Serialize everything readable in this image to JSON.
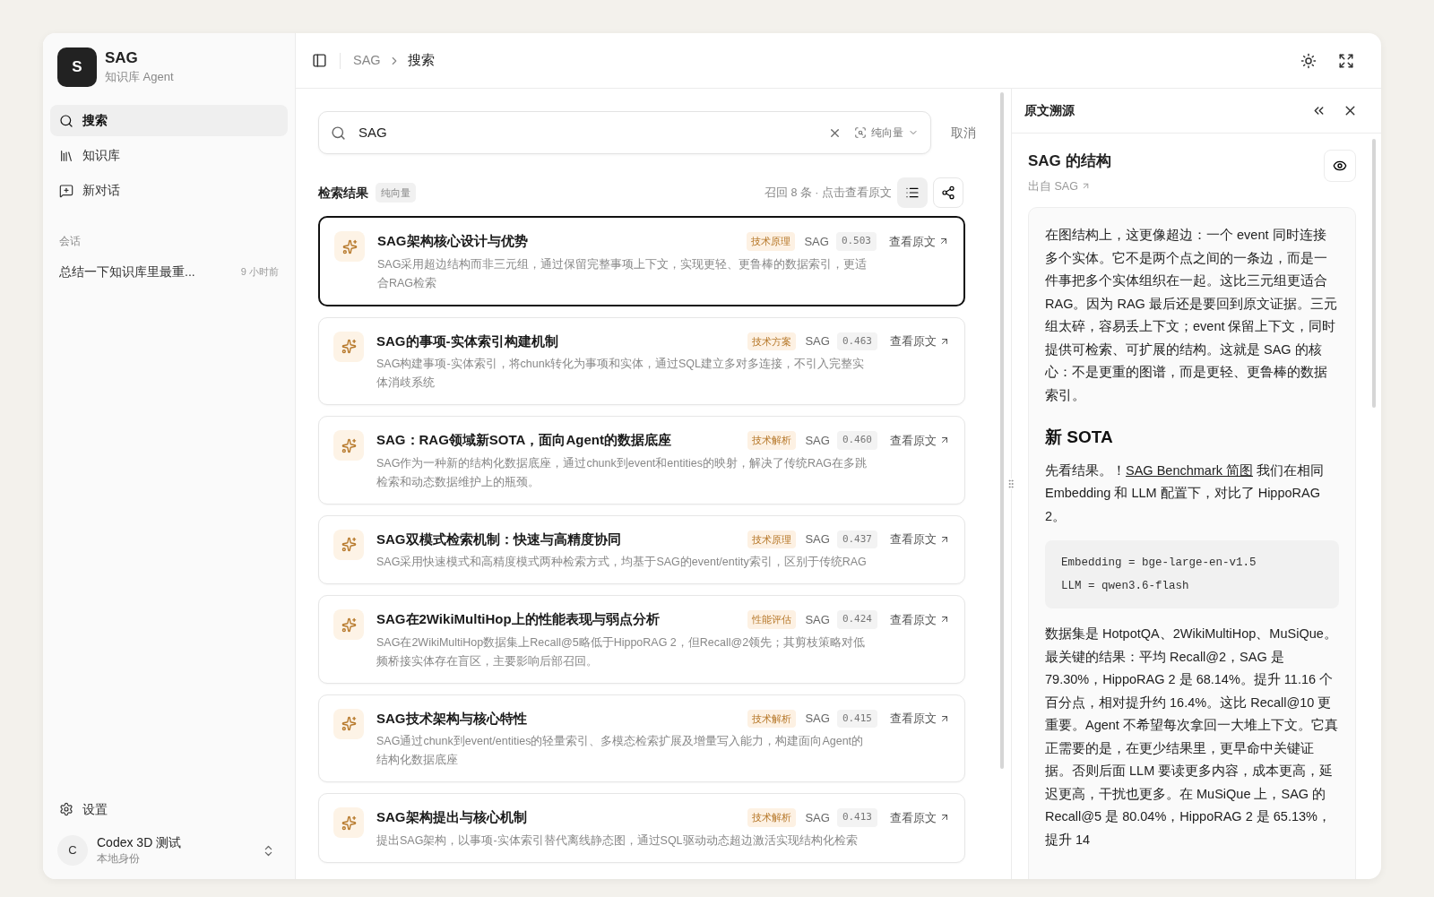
{
  "sidebar": {
    "brand": {
      "logo": "S",
      "name": "SAG",
      "subtitle": "知识库 Agent"
    },
    "nav": [
      {
        "label": "搜索",
        "kind": "search",
        "selected": true
      },
      {
        "label": "知识库",
        "kind": "library",
        "selected": false
      },
      {
        "label": "新对话",
        "kind": "chat",
        "selected": false
      }
    ],
    "section_label": "会话",
    "sessions": [
      {
        "title": "总结一下知识库里最重...",
        "time": "9 小时前"
      }
    ],
    "settings": "设置",
    "user": {
      "avatar": "C",
      "name": "Codex 3D 测试",
      "subtitle": "本地身份"
    }
  },
  "breadcrumb": [
    "SAG",
    "搜索"
  ],
  "search": {
    "value": "SAG",
    "mode": "纯向量",
    "cancel": "取消"
  },
  "results": {
    "title": "检索结果",
    "mode_badge": "纯向量",
    "summary": "召回 8 条 · 点击查看原文",
    "view_modes": [
      {
        "kind": "list",
        "selected": true
      },
      {
        "kind": "graph",
        "selected": false
      }
    ],
    "items": [
      {
        "title": "SAG架构核心设计与优势",
        "summary": "SAG采用超边结构而非三元组，通过保留完整事项上下文，实现更轻、更鲁棒的数据索引，更适合RAG检索",
        "tag": "技术原理",
        "source": "SAG",
        "score": "0.503",
        "link": "查看原文",
        "selected": true
      },
      {
        "title": "SAG的事项-实体索引构建机制",
        "summary": "SAG构建事项-实体索引，将chunk转化为事项和实体，通过SQL建立多对多连接，不引入完整实体消歧系统",
        "tag": "技术方案",
        "source": "SAG",
        "score": "0.463",
        "link": "查看原文",
        "selected": false
      },
      {
        "title": "SAG：RAG领域新SOTA，面向Agent的数据底座",
        "summary": "SAG作为一种新的结构化数据底座，通过chunk到event和entities的映射，解决了传统RAG在多跳检索和动态数据维护上的瓶颈。",
        "tag": "技术解析",
        "source": "SAG",
        "score": "0.460",
        "link": "查看原文",
        "selected": false
      },
      {
        "title": "SAG双模式检索机制：快速与高精度协同",
        "summary": "SAG采用快速模式和高精度模式两种检索方式，均基于SAG的event/entity索引，区别于传统RAG",
        "tag": "技术原理",
        "source": "SAG",
        "score": "0.437",
        "link": "查看原文",
        "selected": false
      },
      {
        "title": "SAG在2WikiMultiHop上的性能表现与弱点分析",
        "summary": "SAG在2WikiMultiHop数据集上Recall@5略低于HippoRAG 2，但Recall@2领先；其剪枝策略对低频桥接实体存在盲区，主要影响后部召回。",
        "tag": "性能评估",
        "source": "SAG",
        "score": "0.424",
        "link": "查看原文",
        "selected": false
      },
      {
        "title": "SAG技术架构与核心特性",
        "summary": "SAG通过chunk到event/entities的轻量索引、多模态检索扩展及增量写入能力，构建面向Agent的结构化数据底座",
        "tag": "技术解析",
        "source": "SAG",
        "score": "0.415",
        "link": "查看原文",
        "selected": false
      },
      {
        "title": "SAG架构提出与核心机制",
        "summary": "提出SAG架构，以事项-实体索引替代离线静态图，通过SQL驱动动态超边激活实现结构化检索",
        "tag": "技术解析",
        "source": "SAG",
        "score": "0.413",
        "link": "查看原文",
        "selected": false
      }
    ]
  },
  "source_panel": {
    "title": "原文溯源",
    "doc_title": "SAG 的结构",
    "origin": "出自 SAG",
    "paragraph_1": "在图结构上，这更像超边：一个 event 同时连接多个实体。它不是两个点之间的一条边，而是一件事把多个实体组织在一起。这比三元组更适合 RAG。因为 RAG 最后还是要回到原文证据。三元组太碎，容易丢上下文；event 保留上下文，同时提供可检索、可扩展的结构。这就是 SAG 的核心：不是更重的图谱，而是更轻、更鲁棒的数据索引。",
    "heading": "新 SOTA",
    "intro": {
      "before": "先看结果。！",
      "link": "SAG Benchmark 简图",
      "after": " 我们在相同 Embedding 和 LLM 配置下，对比了 HippoRAG 2。"
    },
    "code": [
      "Embedding = bge-large-en-v1.5",
      "LLM = qwen3.6-flash"
    ],
    "paragraph_2": "数据集是 HotpotQA、2WikiMultiHop、MuSiQue。最关键的结果：平均 Recall@2，SAG 是 79.30%，HippoRAG 2 是 68.14%。提升 11.16 个百分点，相对提升约 16.4%。这比 Recall@10 更重要。Agent 不希望每次拿回一大堆上下文。它真正需要的是，在更少结果里，更早命中关键证据。否则后面 LLM 要读更多内容，成本更高，延迟更高，干扰也更多。在 MuSiQue 上，SAG 的 Recall@5 是 80.04%，HippoRAG 2 是 65.13%，提升 14"
  }
}
